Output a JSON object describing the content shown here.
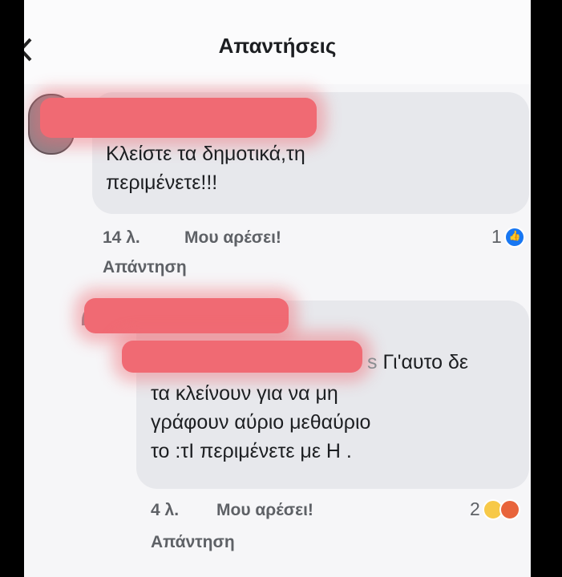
{
  "header": {
    "title": "Απαντήσεις"
  },
  "comments": [
    {
      "text": "Κλείστε τα δημοτικά,τη\nπεριμένετε!!!",
      "time": "14 λ.",
      "like_label": "Μου αρέσει!",
      "reply_label": "Απάντηση",
      "reaction_count": "1",
      "reactions": [
        "like-icon"
      ]
    },
    {
      "text_tail": "s",
      "text_first": " Γι'αυτο δε",
      "text_rest": "τα κλείνουν για να μη\nγράφουν αύριο μεθαύριο\nτο :τΙ περιμένετε με Η .",
      "time": "4 λ.",
      "like_label": "Μου αρέσει!",
      "reply_label": "Απάντηση",
      "reaction_count": "2",
      "reactions": [
        "haha-icon",
        "angry-icon"
      ]
    }
  ],
  "colors": {
    "bubble": "#e7e8ec",
    "redaction": "#f06a73",
    "like": "#1877f2"
  }
}
